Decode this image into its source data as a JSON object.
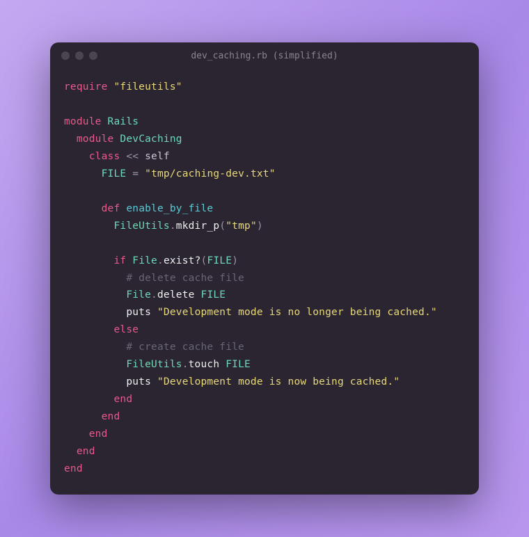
{
  "titlebar": {
    "title": "dev_caching.rb (simplified)"
  },
  "code": {
    "l1": {
      "require": "require",
      "sp": " ",
      "str": "\"fileutils\""
    },
    "l2": "",
    "l3": {
      "module": "module",
      "sp": " ",
      "name": "Rails"
    },
    "l4": {
      "indent": "  ",
      "module": "module",
      "sp": " ",
      "name": "DevCaching"
    },
    "l5": {
      "indent": "    ",
      "class": "class",
      "sp": " ",
      "lshift": "<< ",
      "self": "self"
    },
    "l6": {
      "indent": "      ",
      "const": "FILE",
      "sp": " ",
      "eq": "=",
      "sp2": " ",
      "str": "\"tmp/caching-dev.txt\""
    },
    "l7": "",
    "l8": {
      "indent": "      ",
      "def": "def",
      "sp": " ",
      "method": "enable_by_file"
    },
    "l9": {
      "indent": "        ",
      "recv": "FileUtils",
      "dot": ".",
      "call": "mkdir_p",
      "lp": "(",
      "arg": "\"tmp\"",
      "rp": ")"
    },
    "l10": "",
    "l11": {
      "indent": "        ",
      "if": "if",
      "sp": " ",
      "recv": "File",
      "dot": ".",
      "call": "exist?",
      "lp": "(",
      "arg": "FILE",
      "rp": ")"
    },
    "l12": {
      "indent": "          ",
      "comment": "# delete cache file"
    },
    "l13": {
      "indent": "          ",
      "recv": "File",
      "dot": ".",
      "call": "delete",
      "sp": " ",
      "arg": "FILE"
    },
    "l14": {
      "indent": "          ",
      "puts": "puts",
      "sp": " ",
      "str": "\"Development mode is no longer being cached.\""
    },
    "l15": {
      "indent": "        ",
      "else": "else"
    },
    "l16": {
      "indent": "          ",
      "comment": "# create cache file"
    },
    "l17": {
      "indent": "          ",
      "recv": "FileUtils",
      "dot": ".",
      "call": "touch",
      "sp": " ",
      "arg": "FILE"
    },
    "l18": {
      "indent": "          ",
      "puts": "puts",
      "sp": " ",
      "str": "\"Development mode is now being cached.\""
    },
    "l19": {
      "indent": "        ",
      "end": "end"
    },
    "l20": {
      "indent": "      ",
      "end": "end"
    },
    "l21": {
      "indent": "    ",
      "end": "end"
    },
    "l22": {
      "indent": "  ",
      "end": "end"
    },
    "l23": {
      "end": "end"
    }
  }
}
